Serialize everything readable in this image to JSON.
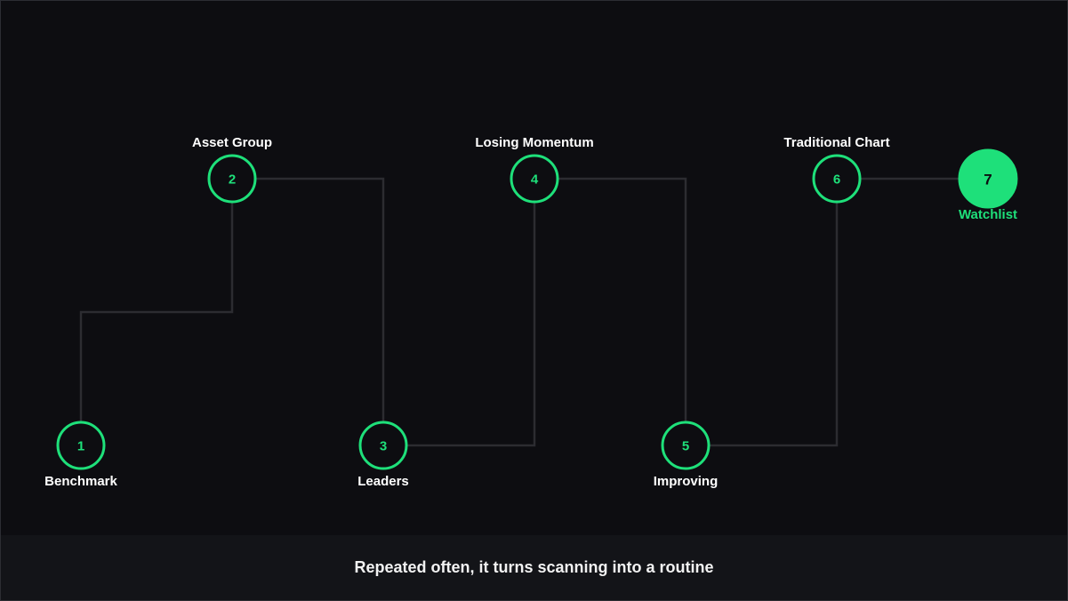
{
  "diagram": {
    "nodes": [
      {
        "id": "1",
        "number": "1",
        "label": "Benchmark"
      },
      {
        "id": "2",
        "number": "2",
        "label": "Asset Group"
      },
      {
        "id": "3",
        "number": "3",
        "label": "Leaders"
      },
      {
        "id": "4",
        "number": "4",
        "label": "Losing Momentum"
      },
      {
        "id": "5",
        "number": "5",
        "label": "Improving"
      },
      {
        "id": "6",
        "number": "6",
        "label": "Traditional Chart"
      },
      {
        "id": "7",
        "number": "7",
        "label": "Watchlist",
        "highlighted": true
      }
    ],
    "edges": [
      [
        "1",
        "2"
      ],
      [
        "2",
        "3"
      ],
      [
        "3",
        "4"
      ],
      [
        "4",
        "5"
      ],
      [
        "5",
        "6"
      ],
      [
        "6",
        "7"
      ]
    ]
  },
  "caption": "Repeated often, it turns scanning into a routine",
  "colors": {
    "background": "#0d0d11",
    "accent": "#1ee07a",
    "connector": "#2c2c31",
    "caption_bar": "#131418",
    "text": "#ffffff"
  }
}
